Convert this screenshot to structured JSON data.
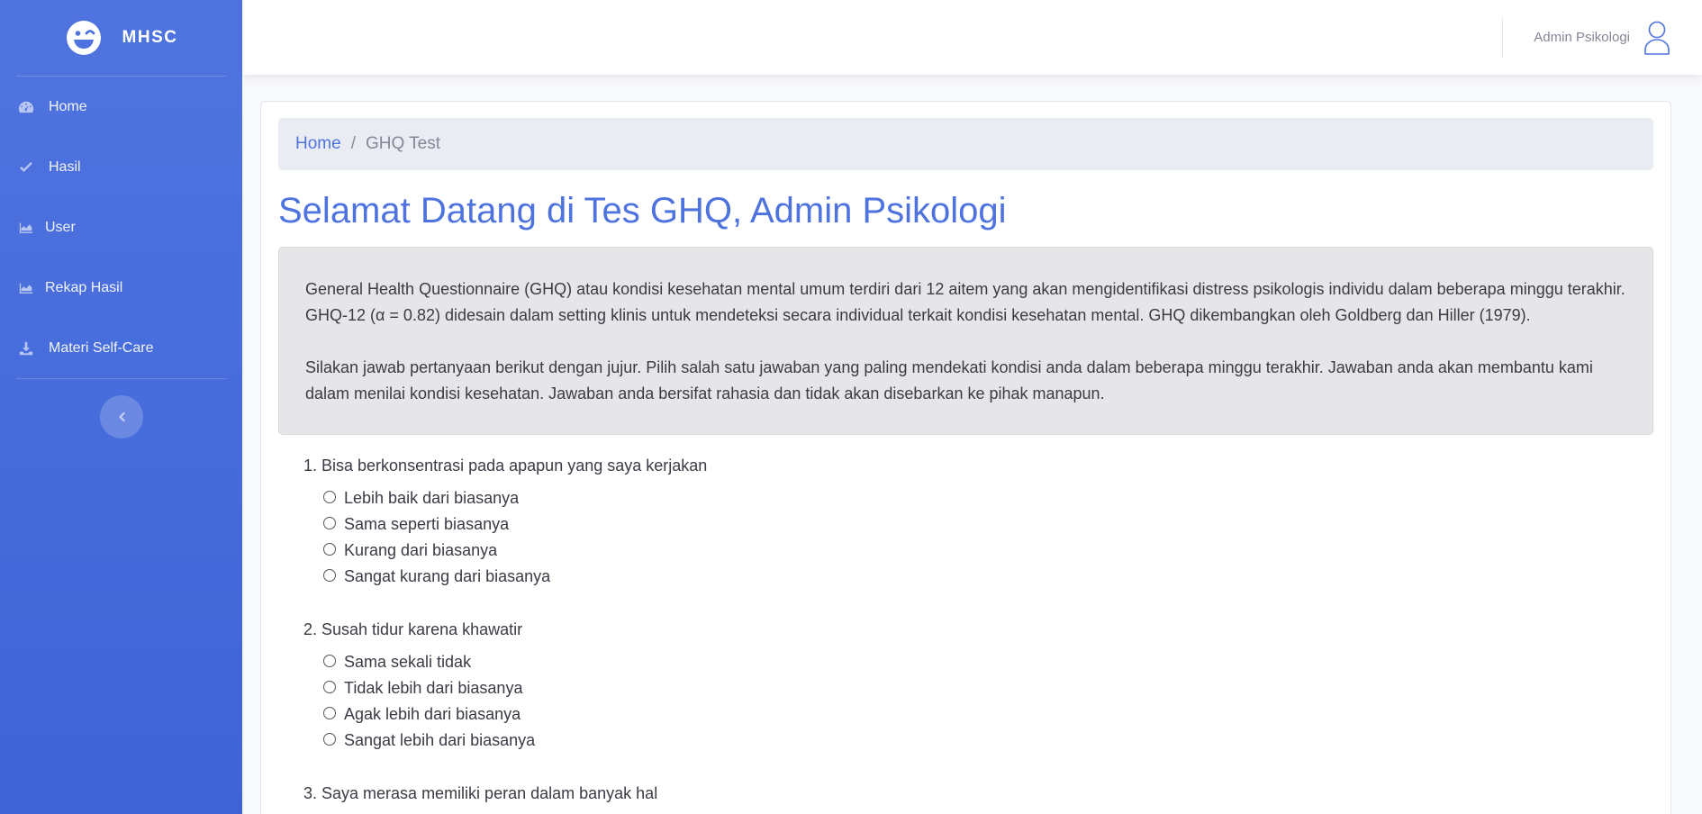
{
  "brand": {
    "name": "MHSC"
  },
  "sidebar": {
    "items": [
      {
        "label": "Home",
        "icon": "tachometer-icon"
      },
      {
        "label": "Hasil",
        "icon": "check-icon"
      },
      {
        "label": "User",
        "icon": "chart-area-icon"
      },
      {
        "label": "Rekap Hasil",
        "icon": "chart-area-icon"
      },
      {
        "label": "Materi Self-Care",
        "icon": "download-icon"
      }
    ],
    "toggle_icon": "chevron-left-icon"
  },
  "topbar": {
    "user_name": "Admin Psikologi",
    "avatar_icon": "user-icon"
  },
  "breadcrumb": {
    "home": "Home",
    "separator": "/",
    "current": "GHQ Test"
  },
  "page": {
    "title": "Selamat Datang di Tes GHQ, Admin Psikologi",
    "intro_1": "General Health Questionnaire (GHQ) atau kondisi kesehatan mental umum terdiri dari 12 aitem yang akan mengidentifikasi distress psikologis individu dalam beberapa minggu terakhir. GHQ-12 (α = 0.82) didesain dalam setting klinis untuk mendeteksi secara individual terkait kondisi kesehatan mental. GHQ dikembangkan oleh Goldberg dan Hiller (1979).",
    "intro_2": "Silakan jawab pertanyaan berikut dengan jujur. Pilih salah satu jawaban yang paling mendekati kondisi anda dalam beberapa minggu terakhir. Jawaban anda akan membantu kami dalam menilai kondisi kesehatan. Jawaban anda bersifat rahasia dan tidak akan disebarkan ke pihak manapun."
  },
  "questions": [
    {
      "text": "1. Bisa berkonsentrasi pada apapun yang saya kerjakan",
      "options": [
        "Lebih baik dari biasanya",
        "Sama seperti biasanya",
        "Kurang dari biasanya",
        "Sangat kurang dari biasanya"
      ]
    },
    {
      "text": "2. Susah tidur karena khawatir",
      "options": [
        "Sama sekali tidak",
        "Tidak lebih dari biasanya",
        "Agak lebih dari biasanya",
        "Sangat lebih dari biasanya"
      ]
    },
    {
      "text": "3. Saya merasa memiliki peran dalam banyak hal",
      "options": []
    }
  ],
  "colors": {
    "primary": "#4e73df",
    "sidebar": "#4e73df",
    "info_bg": "#e6e6e8"
  }
}
